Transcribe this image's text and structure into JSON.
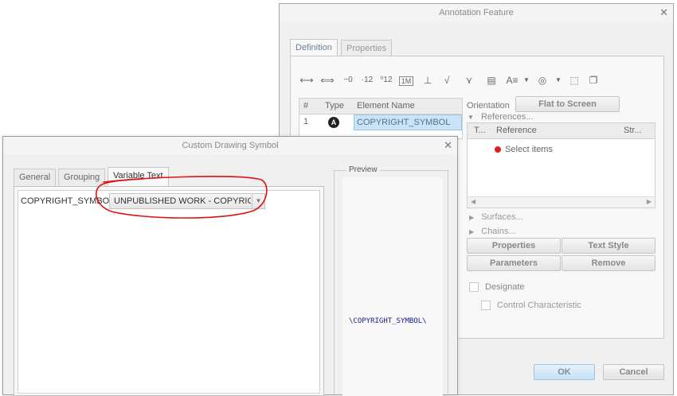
{
  "annotation_dialog": {
    "title": "Annotation Feature",
    "tabs": [
      "Definition",
      "Properties"
    ],
    "toolbar_icons": [
      "dimension-icon",
      "ref-dimension-icon",
      "gtol-icon",
      "ordinate-icon",
      "ordinate-baseline-icon",
      "table-dimension-icon",
      "datum-feature-icon",
      "surface-finish-icon",
      "weld-symbol-icon",
      "note-icon",
      "text-style-icon",
      "dropdown-arrow-icon",
      "symbol-icon",
      "dropdown-arrow-icon",
      "select-box-icon",
      "copy-icon"
    ],
    "table": {
      "headers": [
        "#",
        "Type",
        "Element Name"
      ],
      "rows": [
        {
          "num": "1",
          "type_icon": "copyright-symbol-icon",
          "name": "COPYRIGHT_SYMBOL"
        }
      ]
    },
    "orientation_label": "Orientation",
    "flat_to_screen": "Flat to Screen",
    "references_label": "References...",
    "ref_headers": [
      "T...",
      "Reference",
      "Str..."
    ],
    "select_items": "Select items",
    "surfaces_label": "Surfaces...",
    "chains_label": "Chains...",
    "buttons": {
      "properties": "Properties",
      "text_style": "Text Style",
      "parameters": "Parameters",
      "remove": "Remove"
    },
    "designate": "Designate",
    "control_characteristic": "Control Characteristic",
    "ok": "OK",
    "cancel": "Cancel"
  },
  "symbol_dialog": {
    "title": "Custom Drawing Symbol",
    "tabs": [
      "General",
      "Grouping",
      "Variable Text"
    ],
    "variable_name": "COPYRIGHT_SYMBOL",
    "variable_value": "UNPUBLISHED WORK - COPYRIGHT",
    "preview_label": "Preview",
    "preview_text": "\\COPYRIGHT_SYMBOL\\"
  },
  "colors": {
    "highlight": "#c9e4f6",
    "annotation_circle": "#dd1111",
    "select_dot": "#dd2222",
    "preview_text": "#1a1a8a"
  }
}
